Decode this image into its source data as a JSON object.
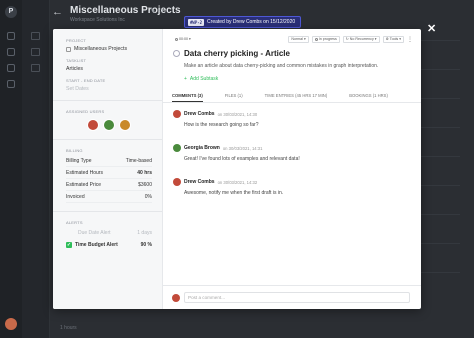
{
  "background": {
    "project_title": "Miscellaneous Projects",
    "project_subtitle": "Workspace Solutions Inc",
    "footer_text": "1 hours"
  },
  "tooltip": {
    "shortcut": "#WP-2",
    "text": "Created by Drew Combs on 15/12/2020"
  },
  "left_panel": {
    "project_label": "Project",
    "project_value": "Miscellaneous Projects",
    "tasklist_label": "Tasklist",
    "tasklist_value": "Articles",
    "dates_label": "Start - End Date",
    "dates_placeholder": "Set Dates",
    "assigned_label": "Assigned Users",
    "billing_label": "Billing",
    "billing_rows": [
      {
        "label": "Billing Type",
        "value": "Time-based"
      },
      {
        "label": "Estimated Hours",
        "value": "40 hrs"
      },
      {
        "label": "Estimated Price",
        "value": "$3600"
      },
      {
        "label": "Invoiced",
        "value": "0%"
      }
    ],
    "alerts_label": "Alerts",
    "alerts": [
      {
        "label": "Due Date Alert",
        "value": "1 days"
      },
      {
        "label": "Time Budget Alert",
        "value": "90 %"
      }
    ]
  },
  "task": {
    "toolbar": {
      "time_chip": "00:00",
      "priority": "Normal",
      "status": "In progress",
      "recurrency": "No Recurrency",
      "more": "Tools"
    },
    "title": "Data cherry picking - Article",
    "description": "Make an article about data cherry-picking and common mistakes in graph interpretation.",
    "add_subtask": "Add Subtask"
  },
  "tabs": [
    {
      "label": "COMMENTS (3)"
    },
    {
      "label": "FILES (1)"
    },
    {
      "label": "TIME ENTRIES (45 HRS 17 MIN)"
    },
    {
      "label": "BOOKINGS (1 HRS)"
    }
  ],
  "comments": [
    {
      "name": "Drew Combs",
      "date": "on 30/03/2021, 14:30",
      "text": "How is the research going so far?"
    },
    {
      "name": "Georgia Brown",
      "date": "on 30/03/2021, 14:31",
      "text": "Great! I've found lots of examples and relevant data!"
    },
    {
      "name": "Drew Combs",
      "date": "on 30/03/2021, 14:32",
      "text": "Awesome, notify me when the first draft is in."
    }
  ],
  "comment_box": {
    "placeholder": "Post a comment..."
  },
  "colors": {
    "accent_green": "#2ebd59",
    "tooltip_bg": "#2a2f78",
    "overlay_bg": "#2b2e33"
  }
}
